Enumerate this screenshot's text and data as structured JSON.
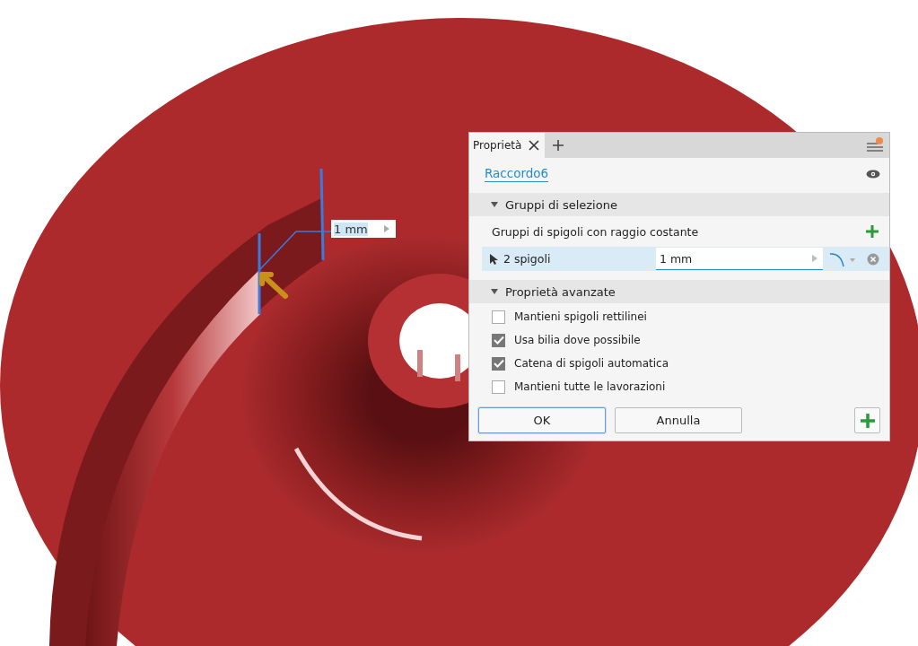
{
  "viewport": {
    "dimension_value": "1 mm"
  },
  "panel": {
    "tabs": [
      {
        "label": "Proprietà",
        "selected": true
      }
    ],
    "feature_name": "Raccordo6",
    "selection_section": {
      "title": "Gruppi di selezione",
      "expanded": true,
      "group_label": "Gruppi di spigoli con raggio costante",
      "rows": [
        {
          "label": "2 spigoli",
          "value": "1 mm",
          "selected": true
        }
      ]
    },
    "advanced_section": {
      "title": "Proprietà avanzate",
      "expanded": true,
      "options": [
        {
          "label": "Mantieni spigoli rettilinei",
          "checked": false
        },
        {
          "label": "Usa bilia dove possibile",
          "checked": true
        },
        {
          "label": "Catena di spigoli automatica",
          "checked": true
        },
        {
          "label": "Mantieni tutte le lavorazioni",
          "checked": false
        }
      ]
    },
    "buttons": [
      "OK",
      "Annulla"
    ]
  }
}
